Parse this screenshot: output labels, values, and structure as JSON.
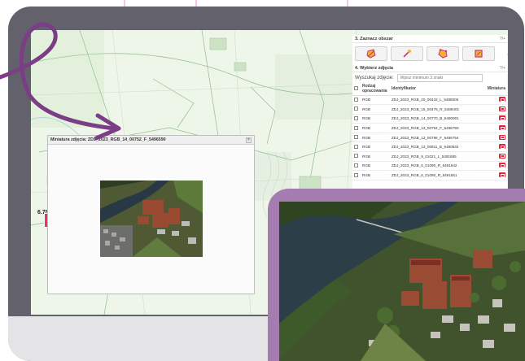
{
  "panel": {
    "section3": {
      "title": "3. Zaznacz obszar",
      "help": "?/+"
    },
    "tools": [
      {
        "icon": "polygon-erase-icon"
      },
      {
        "icon": "wand-icon"
      },
      {
        "icon": "polygon-select-icon"
      },
      {
        "icon": "rectangle-select-icon"
      }
    ],
    "section4": {
      "title": "4. Wybierz zdjęcia",
      "help": "?/+"
    },
    "search": {
      "label": "Wyszukaj zdjęcie:",
      "placeholder": "Wpisz minimum 3 znaki"
    },
    "table": {
      "headers": {
        "type": "Rodzaj opracowania",
        "id": "Identyfikator",
        "thumb": "Miniatura"
      },
      "rows": [
        {
          "type": "RGB",
          "id": "ZDJ_2023_RGB_20_00432_L_5488005"
        },
        {
          "type": "RGB",
          "id": "ZDJ_2023_RGB_15_00475_R_5489401"
        },
        {
          "type": "RGB",
          "id": "ZDJ_2023_RGB_14_00770_B_5480901"
        },
        {
          "type": "RGB",
          "id": "ZDJ_2023_RGB_13_00794_F_5496750"
        },
        {
          "type": "RGB",
          "id": "ZDJ_2023_RGB_13_00796_F_5496754"
        },
        {
          "type": "RGB",
          "id": "ZDJ_2023_RGB_13_00811_B_5490634"
        },
        {
          "type": "RGB",
          "id": "ZDJ_2023_RGB_9_01021_L_5491665"
        },
        {
          "type": "RGB",
          "id": "ZDJ_2023_RGB_6_01090_R_5491542"
        },
        {
          "type": "RGB",
          "id": "ZDJ_2023_RGB_6_01090_R_5491551"
        }
      ]
    }
  },
  "popup": {
    "title": "Miniatura zdjęcia: ZDJ_2023_RGB_14_00752_F_5496590",
    "close": "×"
  },
  "map": {
    "marker_label": "6.78"
  },
  "colors": {
    "frame": "#63616c",
    "accent_purple": "#a57cb0",
    "red_button": "#e2253a",
    "arrow": "#7a3d86"
  }
}
